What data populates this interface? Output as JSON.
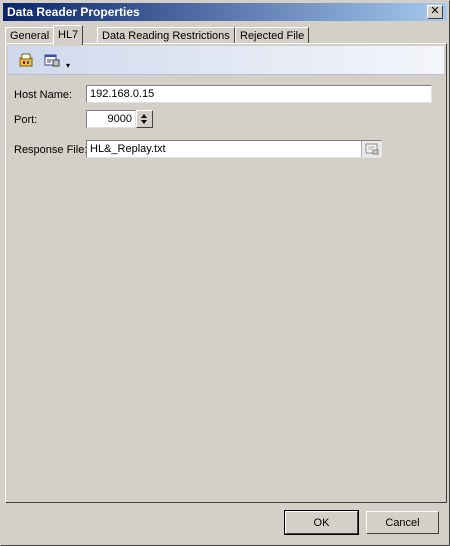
{
  "window": {
    "title": "Data Reader Properties",
    "close_glyph": "✕"
  },
  "tabs": [
    {
      "label": "General",
      "active": false
    },
    {
      "label": "HL7",
      "active": true
    },
    {
      "label": "Data Reading Restrictions",
      "active": false
    },
    {
      "label": "Rejected File",
      "active": false
    }
  ],
  "toolbar": {
    "icons": [
      "categorize-icon",
      "properties-icon"
    ],
    "chevron_glyph": "▾"
  },
  "form": {
    "host_name": {
      "label": "Host Name:",
      "value": "192.168.0.15"
    },
    "port": {
      "label": "Port:",
      "value": "9000"
    },
    "response_file": {
      "label": "Response File:",
      "value": "HL&_Replay.txt"
    }
  },
  "buttons": {
    "ok": "OK",
    "cancel": "Cancel"
  },
  "colors": {
    "title_start": "#0a246a",
    "title_end": "#a6caf0",
    "face": "#d4d0c8"
  }
}
